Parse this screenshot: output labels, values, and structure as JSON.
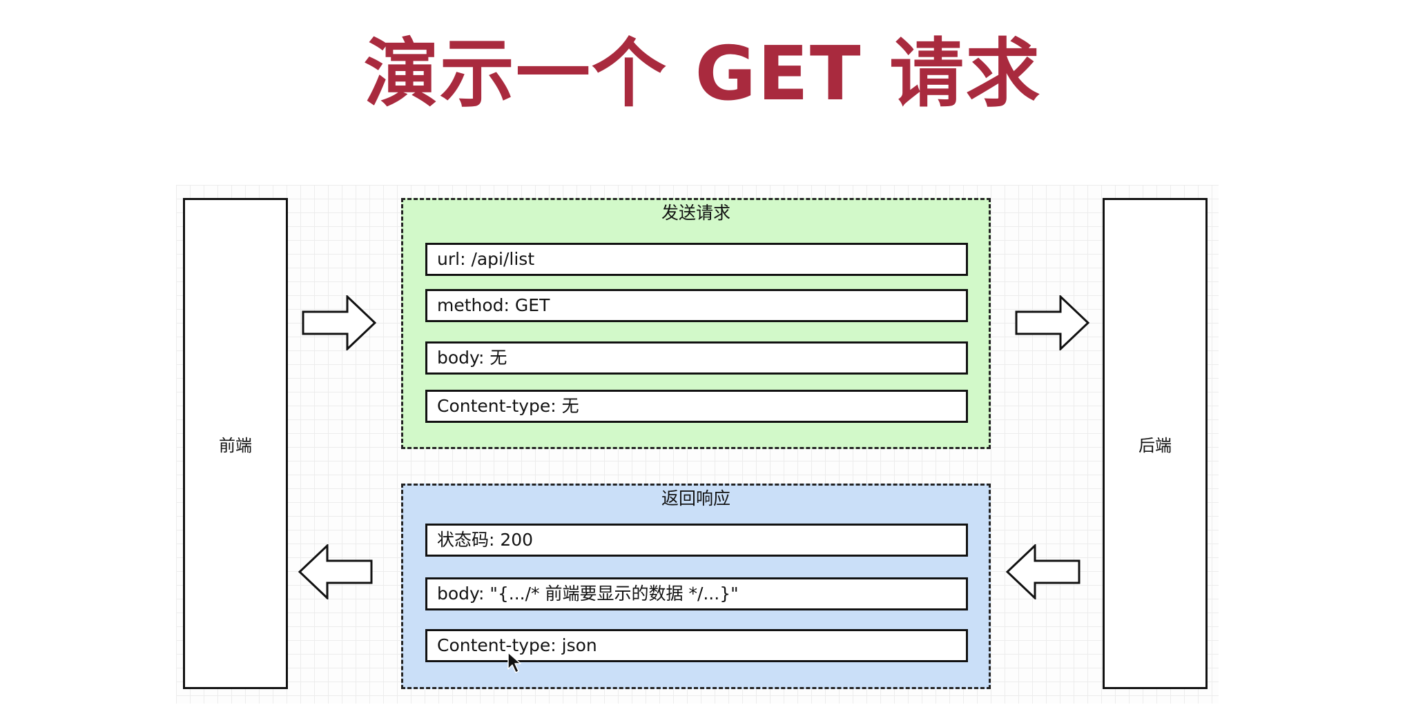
{
  "title": "演示一个 GET 请求",
  "frontend_label": "前端",
  "backend_label": "后端",
  "request": {
    "title": "发送请求",
    "fields": [
      "url: /api/list",
      "method: GET",
      "body: 无",
      "Content-type: 无"
    ],
    "color": "#d2f9c9"
  },
  "response": {
    "title": "返回响应",
    "fields": [
      "状态码: 200",
      "body: \"{.../* 前端要显示的数据 */...}\"",
      "Content-type: json"
    ],
    "color": "#cadff8"
  },
  "colors": {
    "title": "#a92a3e",
    "stroke": "#111111"
  },
  "icons": {
    "request_arrows": "arrow-right-icon",
    "response_arrows": "arrow-left-icon",
    "pointer": "mouse-cursor-icon"
  }
}
